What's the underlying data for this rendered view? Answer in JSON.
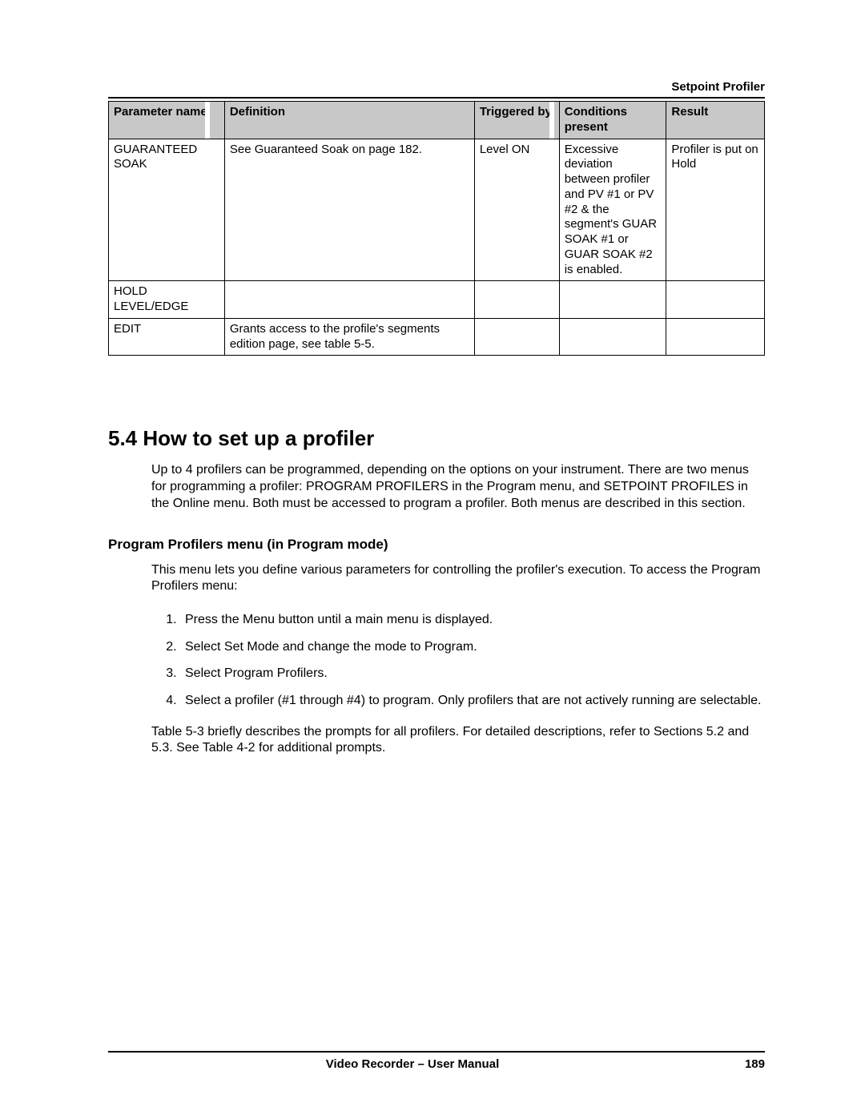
{
  "header": {
    "section_label": "Setpoint Profiler"
  },
  "table": {
    "headers": {
      "param": "Parameter name",
      "definition": "Definition",
      "triggered": "Triggered by",
      "conditions": "Conditions present",
      "result": "Result"
    },
    "rows": [
      {
        "param": "GUARANTEED SOAK",
        "definition": "See Guaranteed Soak on page 182.",
        "triggered": "Level ON",
        "conditions": "Excessive deviation between profiler and PV #1 or PV #2 & the segment's GUAR SOAK #1 or GUAR SOAK #2 is enabled.",
        "result": "Profiler is put on Hold"
      },
      {
        "param": "HOLD LEVEL/EDGE",
        "definition": "",
        "triggered": "",
        "conditions": "",
        "result": ""
      },
      {
        "param": "EDIT",
        "definition": "Grants access to the profile's segments edition page, see table 5-5.",
        "triggered": "",
        "conditions": "",
        "result": ""
      }
    ]
  },
  "section": {
    "title": "5.4  How to set up a profiler",
    "intro": "Up to 4 profilers can be programmed, depending on the options on your instrument.  There are two menus for programming a profiler: PROGRAM PROFILERS in the Program menu, and SETPOINT PROFILES in the Online menu.  Both must be accessed to program a profiler.  Both menus are described in this section.",
    "subhead": "Program Profilers menu (in Program mode)",
    "subintro": "This menu lets you define various parameters for controlling the profiler's execution.  To access the Program Profilers menu:",
    "steps": [
      "Press the Menu button until a main menu is displayed.",
      "Select Set Mode and change the mode to Program.",
      "Select Program Profilers.",
      "Select a profiler (#1 through #4) to program.  Only profilers that are not actively running are selectable."
    ],
    "after": "Table 5-3 briefly describes the prompts for all profilers.  For detailed descriptions, refer to Sections 5.2 and 5.3.  See Table 4-2 for additional prompts."
  },
  "footer": {
    "center": "Video Recorder – User Manual",
    "page": "189"
  }
}
